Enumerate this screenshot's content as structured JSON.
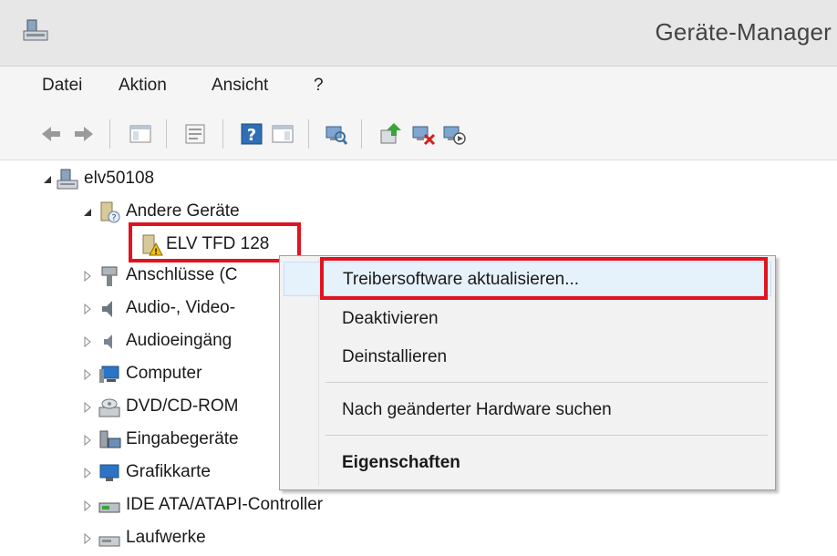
{
  "window": {
    "title": "Geräte-Manager"
  },
  "menu": {
    "items": [
      "Datei",
      "Aktion",
      "Ansicht",
      "?"
    ]
  },
  "toolbar": {
    "buttons": [
      "back-arrow-icon",
      "forward-arrow-icon",
      "show-hide-console-tree-icon",
      "properties-icon",
      "help-icon",
      "action-pane-icon",
      "scan-hardware-icon",
      "update-driver-icon",
      "uninstall-device-icon",
      "disable-device-icon"
    ]
  },
  "tree": {
    "root": "elv50108",
    "other_devices": "Andere Geräte",
    "elv_device": "ELV TFD 128",
    "categories": [
      "Anschlüsse (C",
      "Audio-, Video-",
      "Audioeingäng",
      "Computer",
      "DVD/CD-ROM",
      "Eingabegeräte",
      "Grafikkarte",
      "IDE ATA/ATAPI-Controller",
      "Laufwerke"
    ]
  },
  "context_menu": {
    "update_driver": "Treibersoftware aktualisieren...",
    "disable": "Deaktivieren",
    "uninstall": "Deinstallieren",
    "scan_hardware": "Nach geänderter Hardware suchen",
    "properties": "Eigenschaften"
  },
  "colors": {
    "highlight": "#e0141e",
    "hover": "#e5f1fb"
  }
}
